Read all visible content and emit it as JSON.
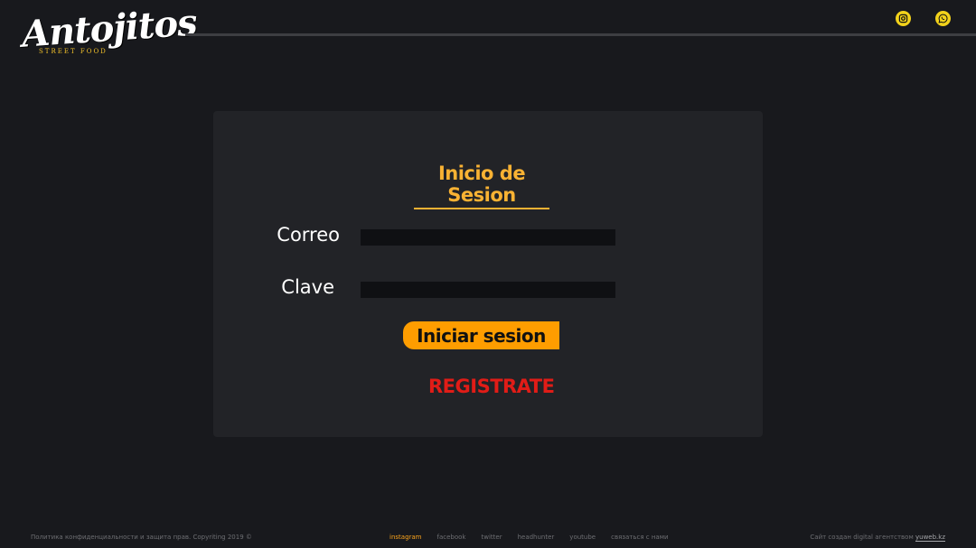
{
  "brand": {
    "name": "Antojitos",
    "tagline": "STREET FOOD"
  },
  "social": [
    "instagram-icon",
    "whatsapp-icon"
  ],
  "login": {
    "title": "Inicio de Sesion",
    "email_label": "Correo",
    "email_value": "",
    "password_label": "Clave",
    "password_value": "",
    "submit": "Iniciar sesion",
    "register": "REGISTRATE"
  },
  "footer": {
    "copyright": "Политика конфиденциальности и защита прав. Copyriting 2019 ©",
    "links": [
      "instagram",
      "facebook",
      "twitter",
      "headhunter",
      "youtube",
      "связаться с нами"
    ],
    "credit": "Сайт создан digital агентством",
    "credit_site": "yuweb.kz"
  },
  "colors": {
    "accent": "#f9b233",
    "button": "#fe9d00",
    "register": "#e11c17",
    "icon_bg": "#f2d21b",
    "background": "#18191d",
    "card": "#222327"
  }
}
